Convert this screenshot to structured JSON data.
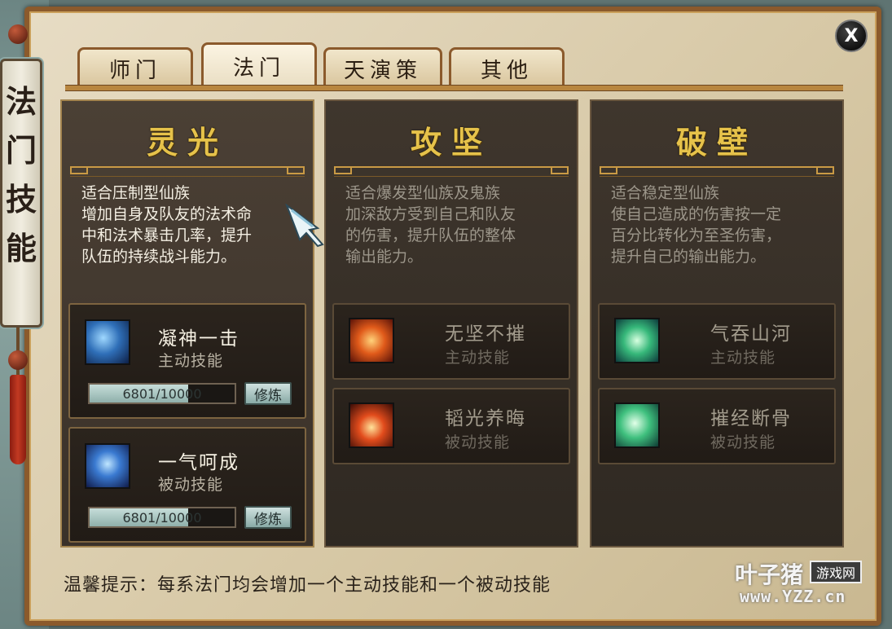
{
  "side_banner": {
    "title_chars": [
      "法",
      "门",
      "技",
      "能"
    ]
  },
  "close": {
    "label": "X"
  },
  "tabs": [
    {
      "label": "师门",
      "active": false
    },
    {
      "label": "法门",
      "active": true
    },
    {
      "label": "天演策",
      "active": false
    },
    {
      "label": "其他",
      "active": false
    }
  ],
  "panels": [
    {
      "title": "灵光",
      "description": [
        "适合压制型仙族",
        "增加自身及队友的法术命",
        "中和法术暴击几率，提升",
        "队伍的持续战斗能力。"
      ],
      "skills": [
        {
          "name": "凝神一击",
          "type": "主动技能",
          "icon": "ice-spirit-icon",
          "progress_text": "6801/10000",
          "progress": 0.68,
          "train_label": "修炼"
        },
        {
          "name": "一气呵成",
          "type": "被动技能",
          "icon": "blue-figure-icon",
          "progress_text": "6801/10000",
          "progress": 0.68,
          "train_label": "修炼"
        }
      ]
    },
    {
      "title": "攻坚",
      "description": [
        "适合爆发型仙族及鬼族",
        "加深敌方受到自己和队友",
        "的伤害，提升队伍的整体",
        "输出能力。"
      ],
      "skills": [
        {
          "name": "无坚不摧",
          "type": "主动技能",
          "icon": "fire-warrior-icon"
        },
        {
          "name": "韬光养晦",
          "type": "被动技能",
          "icon": "flame-figure-icon"
        }
      ]
    },
    {
      "title": "破壁",
      "description": [
        "适合稳定型仙族",
        "使自己造成的伤害按一定",
        "百分比转化为至圣伤害，",
        "提升自己的输出能力。"
      ],
      "skills": [
        {
          "name": "气吞山河",
          "type": "主动技能",
          "icon": "green-beast-icon"
        },
        {
          "name": "摧经断骨",
          "type": "被动技能",
          "icon": "green-claw-icon"
        }
      ]
    }
  ],
  "hint": "温馨提示：每系法门均会增加一个主动技能和一个被动技能",
  "watermark": {
    "brand": "叶子猪",
    "badge": "游戏网",
    "url": "www.YZZ.cn"
  },
  "colors": {
    "title_gold": "#e6c24a",
    "frame_brown": "#8b5a2c",
    "progress_fill": "#a7c6c1"
  }
}
